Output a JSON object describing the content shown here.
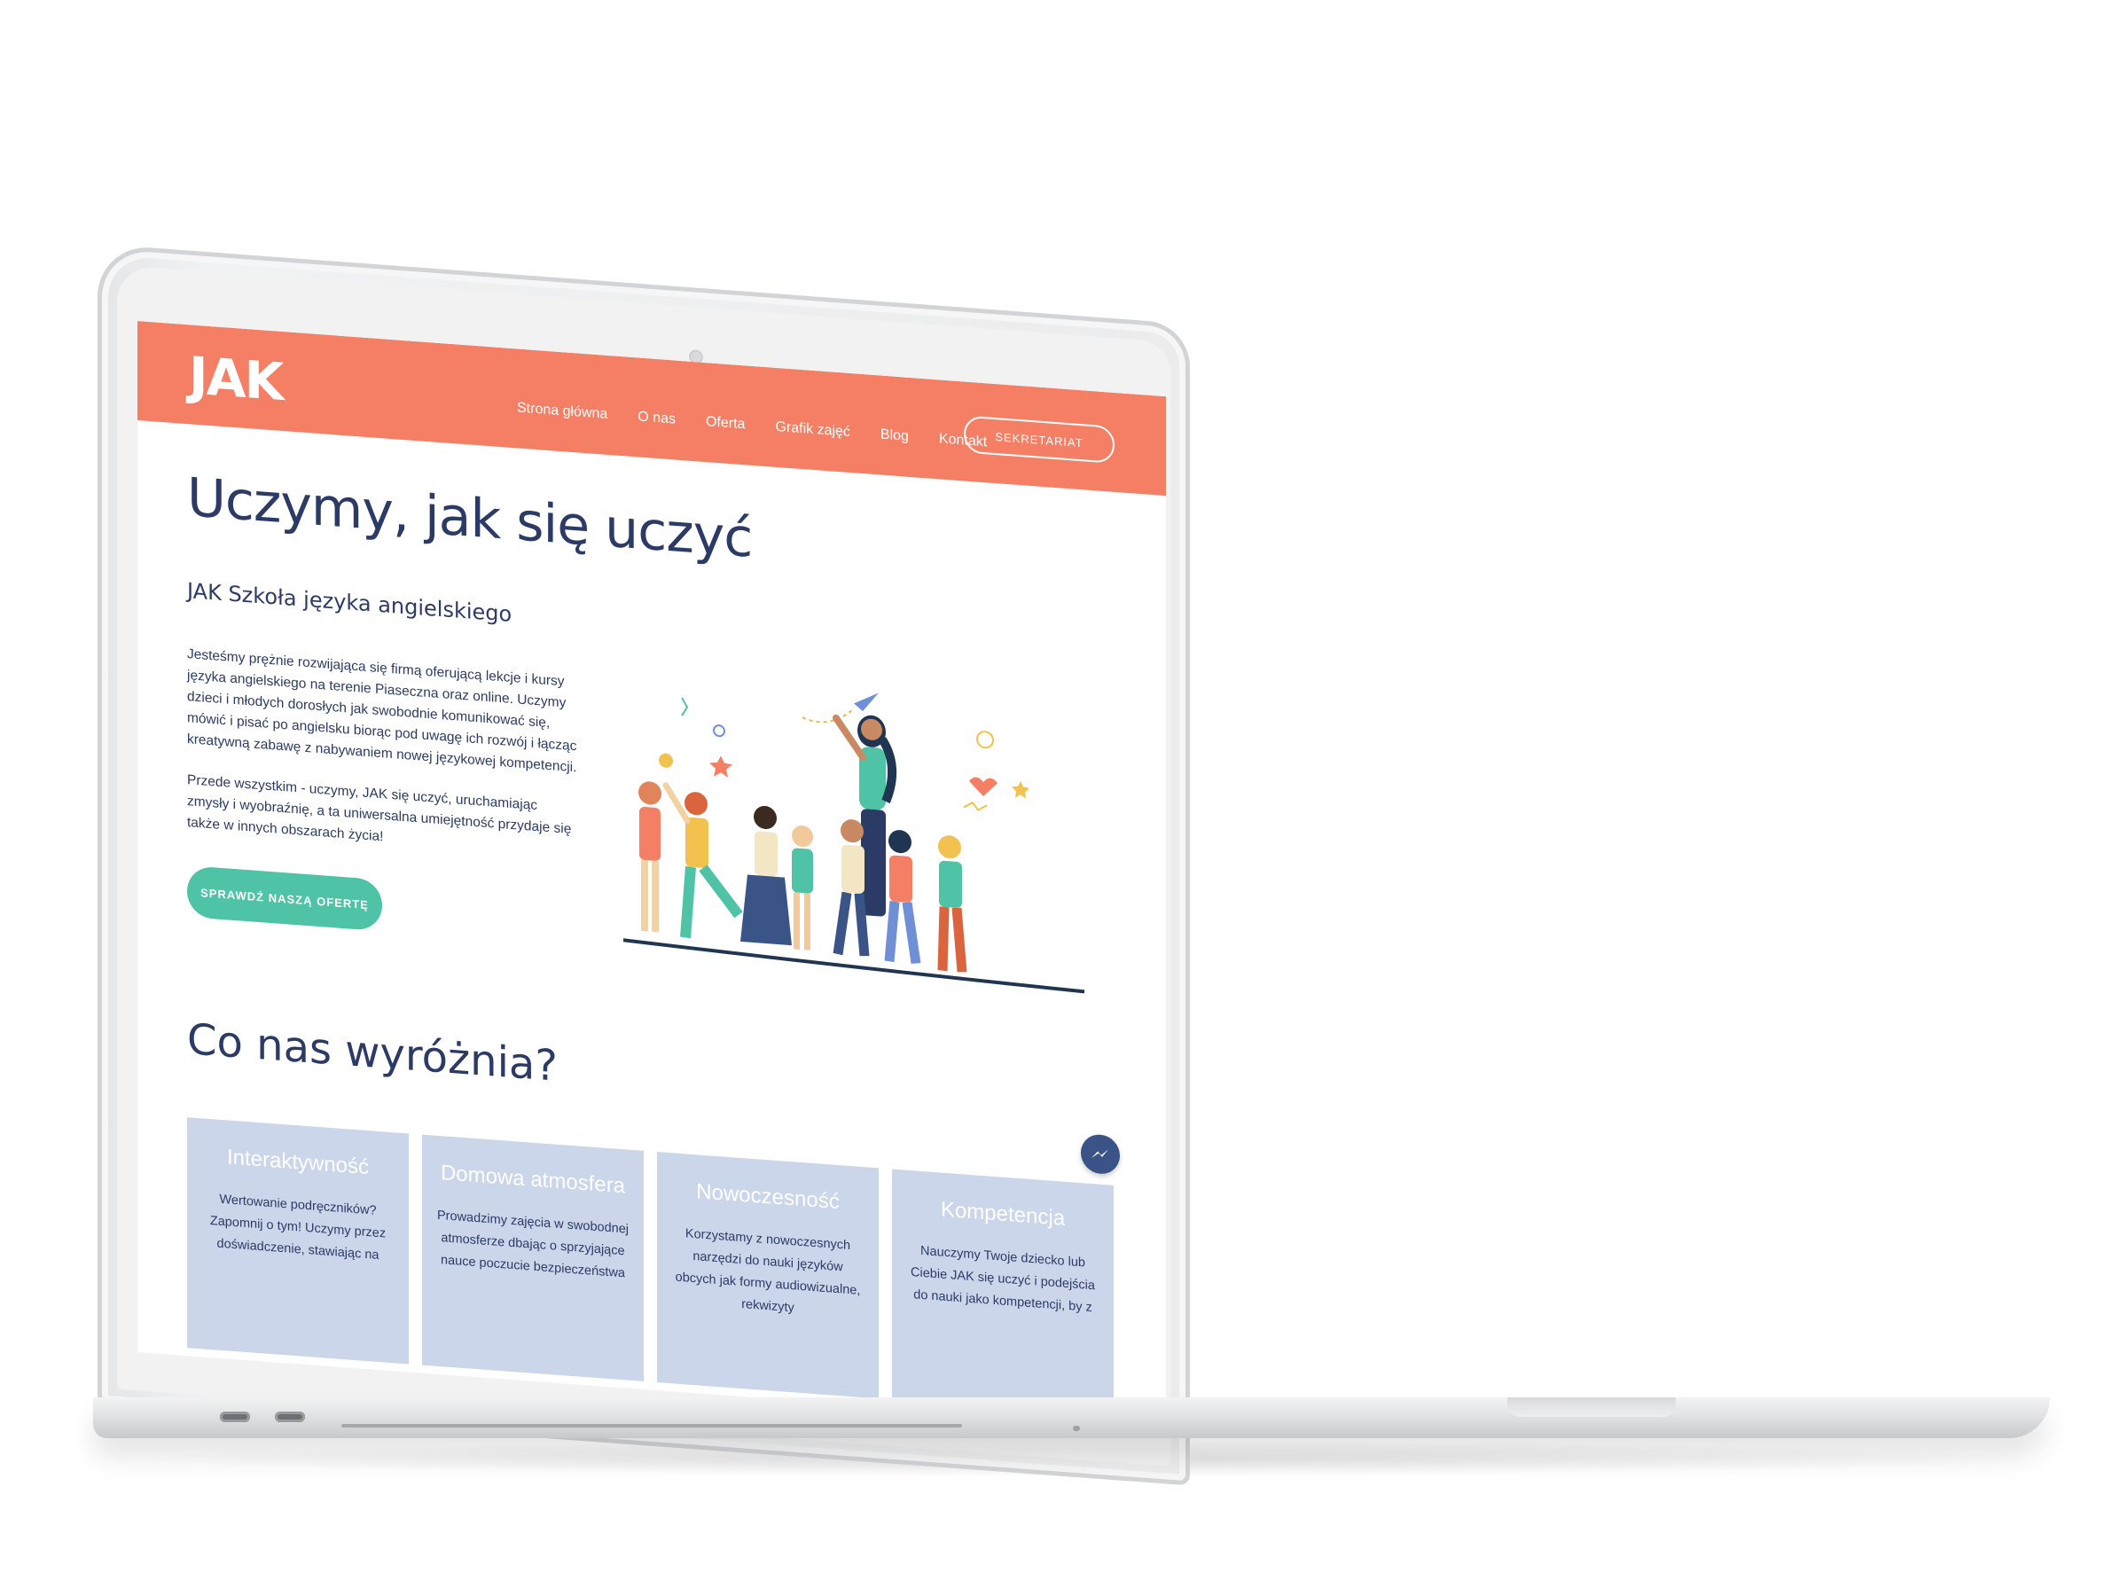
{
  "header": {
    "logo": "JAK",
    "nav": [
      "Strona główna",
      "O nas",
      "Oferta",
      "Grafik zajęć",
      "Blog",
      "Kontakt"
    ],
    "cta": "SEKRETARIAT"
  },
  "hero": {
    "title": "Uczymy, jak się uczyć",
    "subtitle": "JAK Szkoła języka angielskiego",
    "paragraph1": "Jesteśmy prężnie rozwijająca się firmą oferującą lekcje i kursy języka angielskiego na terenie Piaseczna oraz online. Uczymy dzieci i młodych dorosłych jak swobodnie komunikować się, mówić i pisać po angielsku biorąc pod uwagę ich rozwój i łącząc kreatywną zabawę z nabywaniem nowej językowej kompetencji.",
    "paragraph2": "Przede wszystkim - uczymy, JAK się uczyć, uruchamiając zmysły i wyobraźnię, a ta uniwersalna umiejętność przydaje się także w innych obszarach życia!",
    "button": "SPRAWDŹ NASZĄ OFERTĘ"
  },
  "features": {
    "title": "Co nas wyróżnia?",
    "cards": [
      {
        "title": "Interaktywność",
        "text": "Wertowanie podręczników? Zapomnij o tym! Uczymy przez doświadczenie, stawiając na"
      },
      {
        "title": "Domowa atmosfera",
        "text": "Prowadzimy zajęcia w swobodnej atmosferze dbając o sprzyjające nauce poczucie bezpieczeństwa"
      },
      {
        "title": "Nowoczesność",
        "text": "Korzystamy z nowoczesnych narzędzi do nauki języków obcych jak formy audiowizualne, rekwizyty"
      },
      {
        "title": "Kompetencja",
        "text": "Nauczymy Twoje dziecko lub Ciebie JAK się uczyć i podejścia do nauki jako kompetencji, by z"
      }
    ]
  },
  "colors": {
    "header": "#f47f64",
    "heading": "#2c3b66",
    "accent": "#4fc3a5",
    "card": "#ccd6ea",
    "messenger": "#3a5488"
  },
  "icons": {
    "chat": "messenger-icon"
  }
}
